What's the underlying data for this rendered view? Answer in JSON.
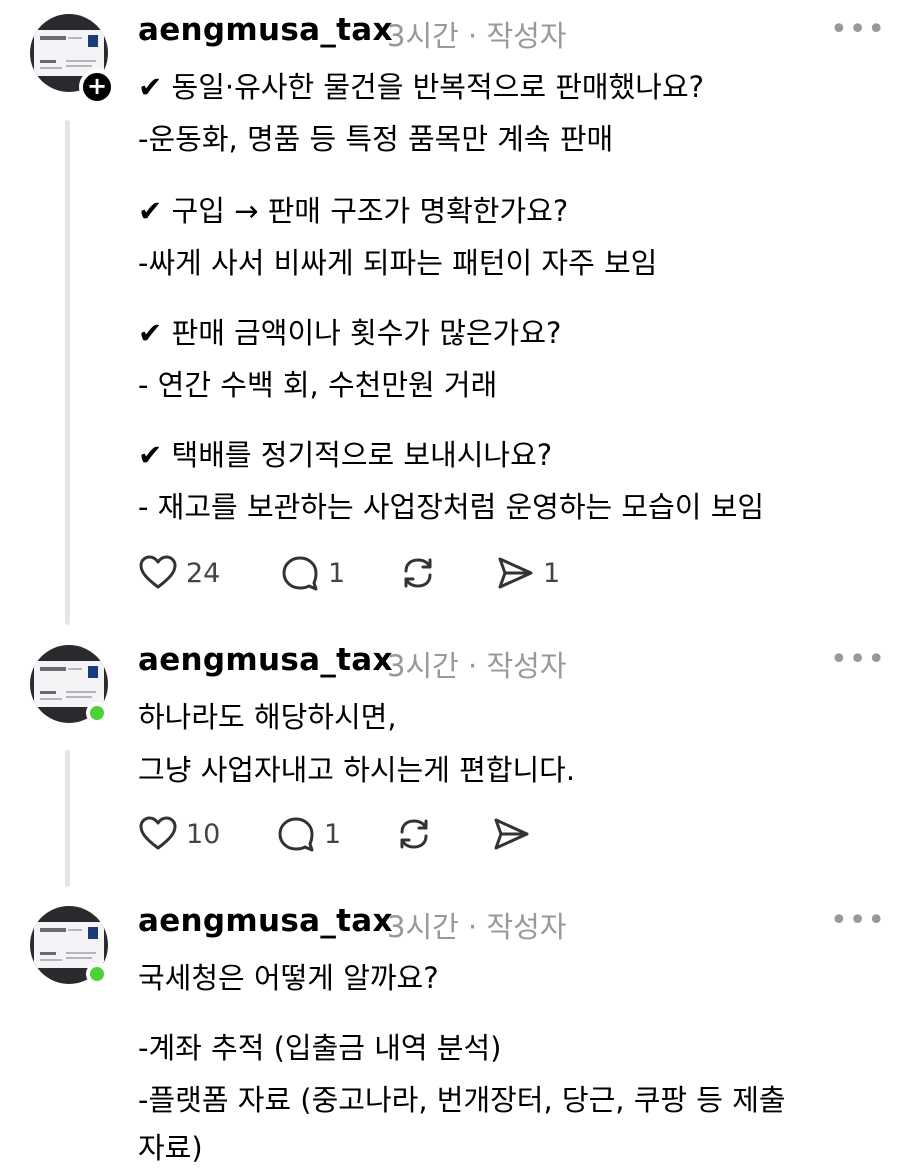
{
  "posts": [
    {
      "username": "aengmusa_tax",
      "time": "3시간",
      "sep": "·",
      "role": "작성자",
      "more": "•••",
      "lines": [
        "✔ 동일·유사한 물건을 반복적으로 판매했나요?",
        "-운동화, 명품 등 특정 품목만 계속 판매",
        "✔ 구입 → 판매 구조가 명확한가요?",
        "-싸게 사서 비싸게 되파는 패턴이 자주 보임",
        "✔ 판매 금액이나 횟수가 많은가요?",
        "- 연간 수백 회, 수천만원 거래",
        "✔ 택배를 정기적으로 보내시나요?",
        "- 재고를 보관하는 사업장처럼 운영하는 모습이 보임"
      ],
      "likes": "24",
      "comments": "1",
      "shares": "1"
    },
    {
      "username": "aengmusa_tax",
      "time": "3시간",
      "sep": "·",
      "role": "작성자",
      "more": "•••",
      "lines": [
        "하나라도 해당하시면,",
        "그냥 사업자내고 하시는게 편합니다."
      ],
      "likes": "10",
      "comments": "1"
    },
    {
      "username": "aengmusa_tax",
      "time": "3시간",
      "sep": "·",
      "role": "작성자",
      "more": "•••",
      "lines": [
        "국세청은 어떻게 알까요?",
        "-계좌 추적 (입출금 내역 분석)",
        "-플랫폼 자료 (중고나라, 번개장터, 당근, 쿠팡 등 제출",
        "자료)"
      ]
    }
  ],
  "colors": {
    "meta_gray": "#999999",
    "online_green": "#4cd137",
    "thread_line": "#e5e5e5"
  },
  "icons": [
    "plus-icon",
    "heart-icon",
    "comment-icon",
    "repost-icon",
    "send-icon",
    "more-icon"
  ]
}
